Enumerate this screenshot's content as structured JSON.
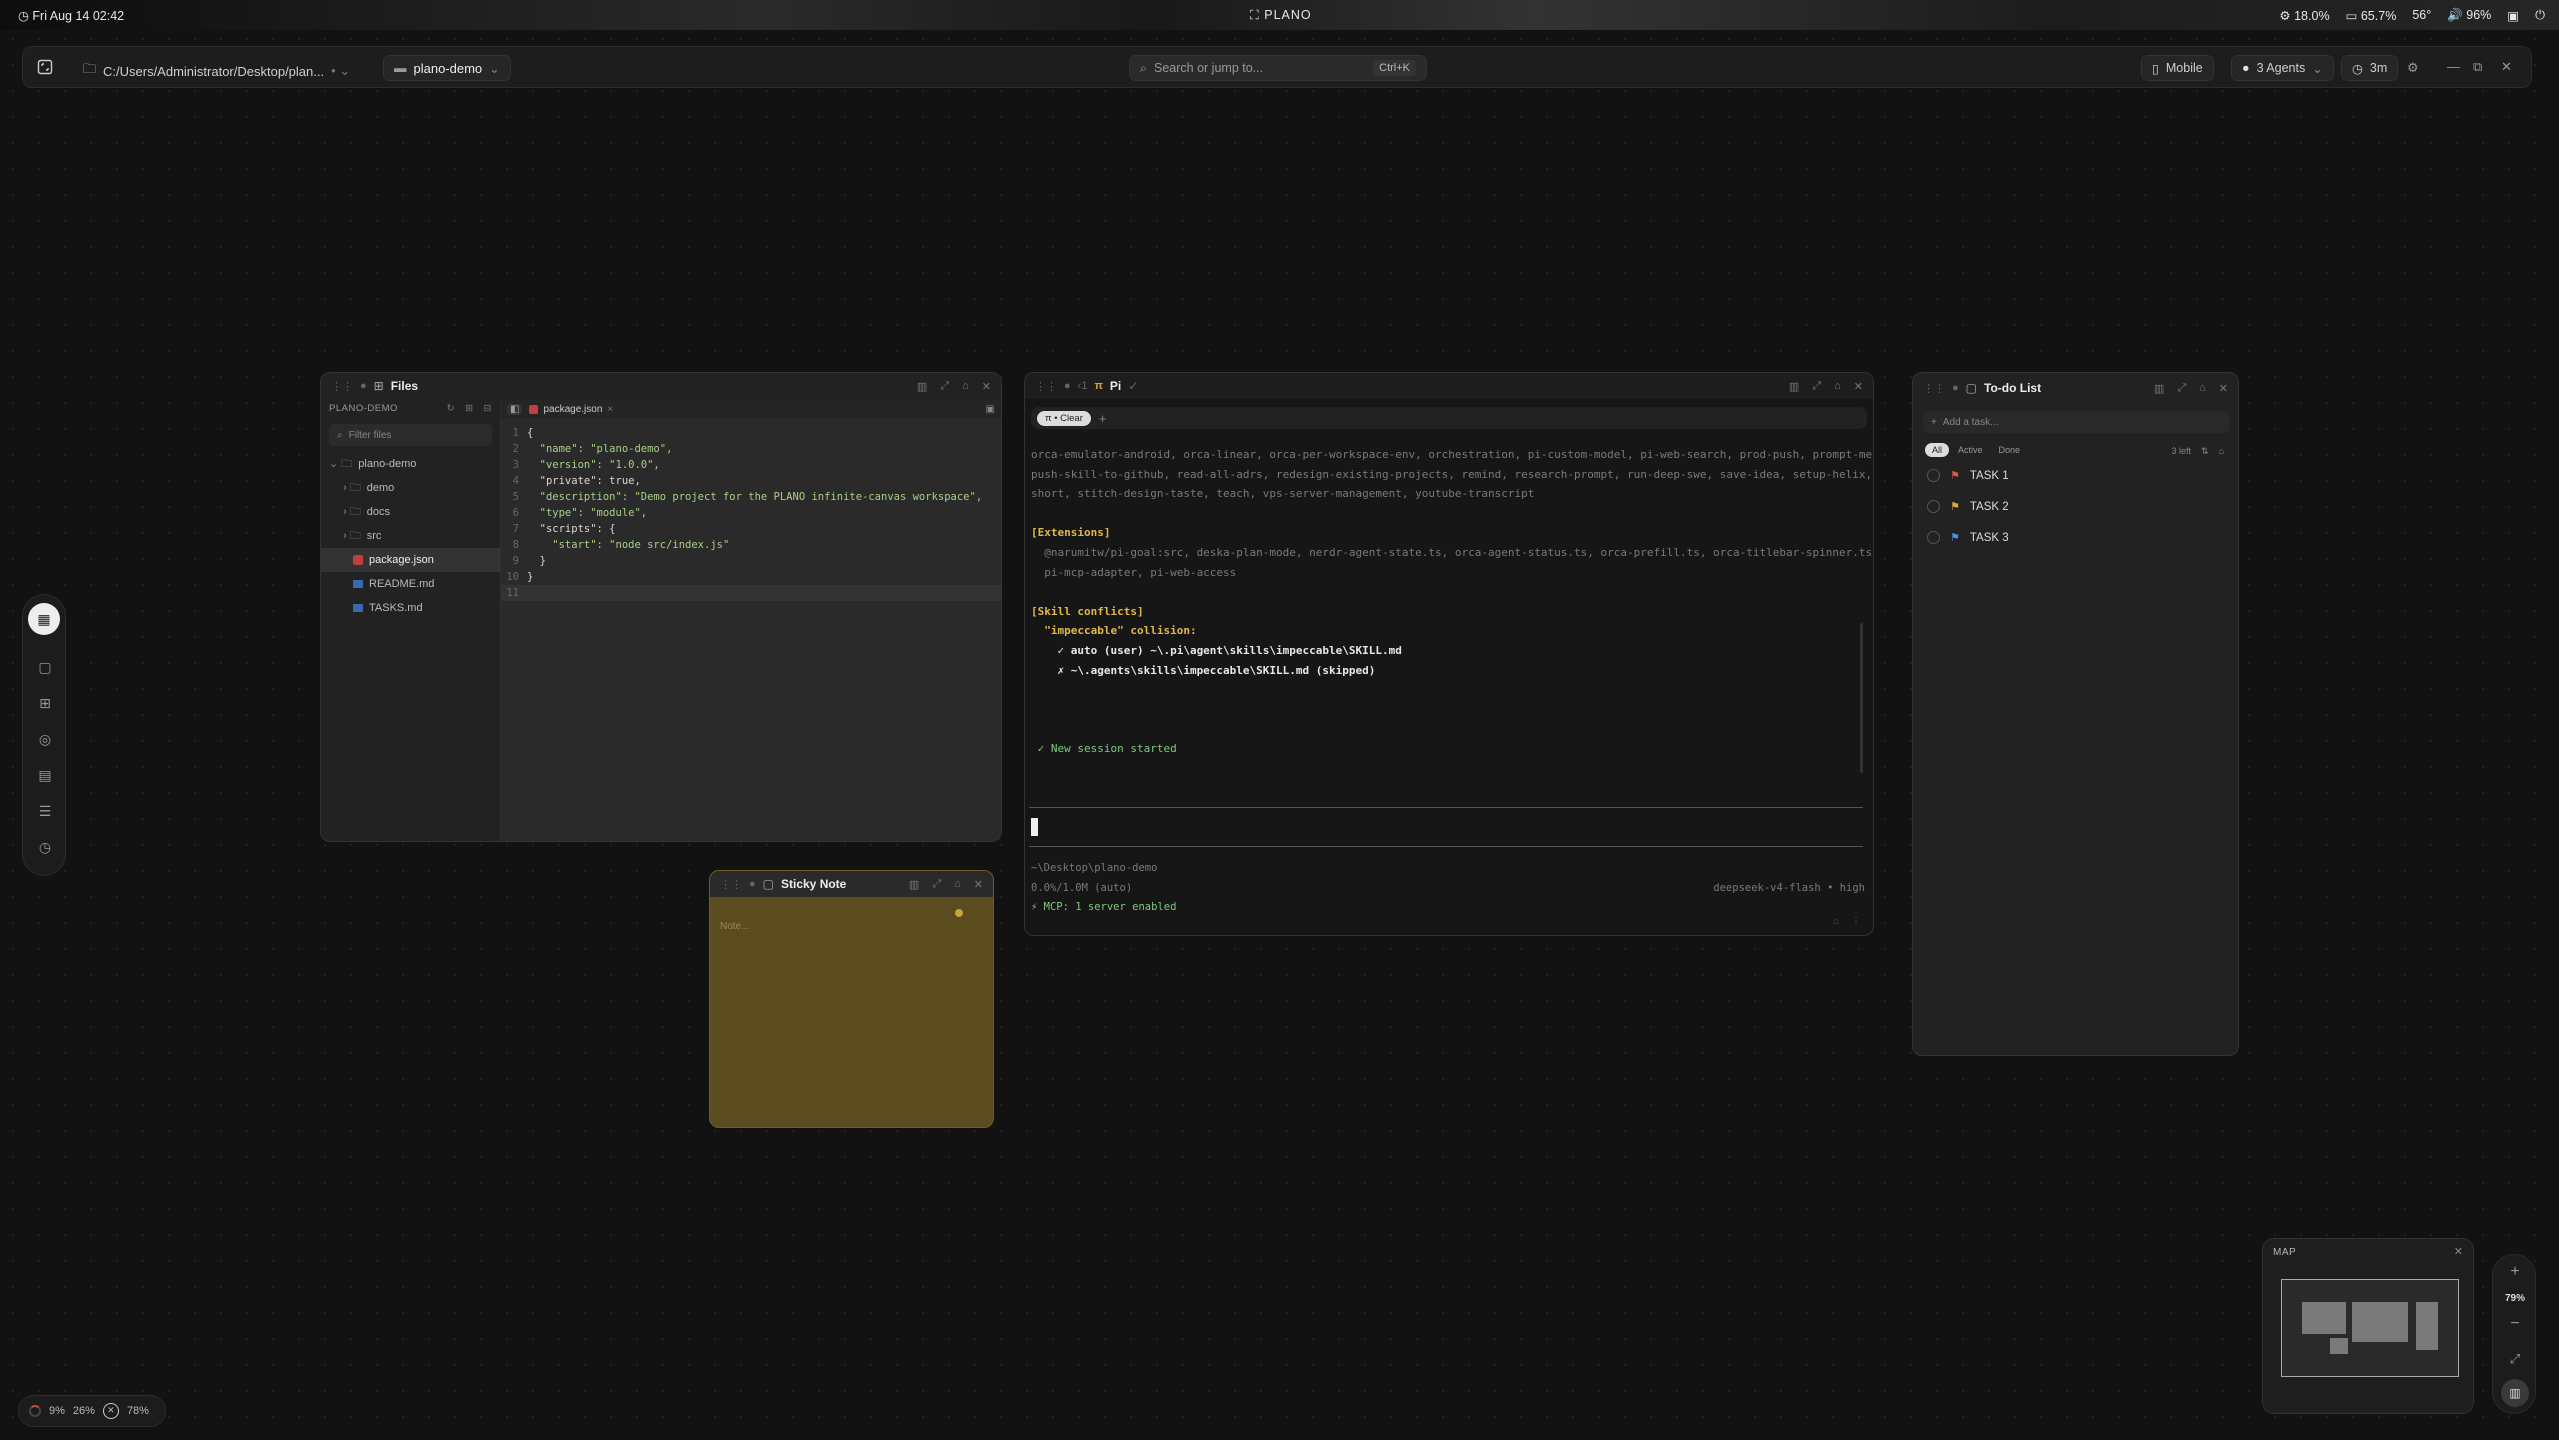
{
  "system_bar": {
    "datetime": "Fri Aug 14 02:42",
    "center_title": "PLANO",
    "cpu": "18.0%",
    "memory": "65.7%",
    "temperature": "56°",
    "volume": "96%"
  },
  "toolbar": {
    "path": "C:/Users/Administrator/Desktop/plan...",
    "project": "plano-demo",
    "search_placeholder": "Search or jump to...",
    "search_shortcut": "Ctrl+K",
    "mobile_label": "Mobile",
    "agents_label": "3 Agents",
    "timer_label": "3m"
  },
  "files_panel": {
    "title": "Files",
    "tree_header": "PLANO-DEMO",
    "filter_placeholder": "Filter files",
    "tree": [
      {
        "label": "plano-demo",
        "type": "folder-open",
        "depth": 0
      },
      {
        "label": "demo",
        "type": "folder",
        "depth": 1
      },
      {
        "label": "docs",
        "type": "folder",
        "depth": 1
      },
      {
        "label": "src",
        "type": "folder",
        "depth": 1
      },
      {
        "label": "package.json",
        "type": "json",
        "depth": 1,
        "active": true
      },
      {
        "label": "README.md",
        "type": "md",
        "depth": 1
      },
      {
        "label": "TASKS.md",
        "type": "md",
        "depth": 1
      }
    ],
    "tab_label": "package.json",
    "code": [
      {
        "n": "1",
        "t": "{"
      },
      {
        "n": "2",
        "t": "  \"name\": \"plano-demo\","
      },
      {
        "n": "3",
        "t": "  \"version\": \"1.0.0\","
      },
      {
        "n": "4",
        "t": "  \"private\": true,"
      },
      {
        "n": "5",
        "t": "  \"description\": \"Demo project for the PLANO infinite-canvas workspace\","
      },
      {
        "n": "6",
        "t": "  \"type\": \"module\","
      },
      {
        "n": "7",
        "t": "  \"scripts\": {"
      },
      {
        "n": "8",
        "t": "    \"start\": \"node src/index.js\""
      },
      {
        "n": "9",
        "t": "  }"
      },
      {
        "n": "10",
        "t": "}"
      },
      {
        "n": "11",
        "t": ""
      }
    ]
  },
  "terminal_panel": {
    "tab_count": "1",
    "title": "Pi",
    "clear_label": "Clear",
    "lines": [
      {
        "style": "dim",
        "text": "orca-emulator-android, orca-linear, orca-per-workspace-env, orchestration, pi-custom-model, pi-web-search, prod-push, prompt-me,"
      },
      {
        "style": "dim",
        "text": "push-skill-to-github, read-all-adrs, redesign-existing-projects, remind, research-prompt, run-deep-swe, save-idea, setup-helix,"
      },
      {
        "style": "dim",
        "text": "short, stitch-design-taste, teach, vps-server-management, youtube-transcript"
      },
      {
        "style": "blank",
        "text": ""
      },
      {
        "style": "yel",
        "text": "[Extensions]"
      },
      {
        "style": "dim",
        "text": "  @narumitw/pi-goal:src, deska-plan-mode, nerdr-agent-state.ts, orca-agent-status.ts, orca-prefill.ts, orca-titlebar-spinner.ts,"
      },
      {
        "style": "dim",
        "text": "  pi-mcp-adapter, pi-web-access"
      },
      {
        "style": "blank",
        "text": ""
      },
      {
        "style": "yel",
        "text": "[Skill conflicts]"
      },
      {
        "style": "yel",
        "text": "  \"impeccable\" collision:"
      },
      {
        "style": "ok",
        "text": "    ✓ auto (user) ~\\.pi\\agent\\skills\\impeccable\\SKILL.md"
      },
      {
        "style": "bad",
        "text": "    ✗ ~\\.agents\\skills\\impeccable\\SKILL.md (skipped)"
      },
      {
        "style": "blank",
        "text": ""
      },
      {
        "style": "blank",
        "text": ""
      },
      {
        "style": "blank",
        "text": ""
      },
      {
        "style": "grn",
        "text": " ✓ New session started"
      }
    ],
    "cwd": "~\\Desktop\\plano-demo",
    "context": "0.0%/1.0M (auto)",
    "model": "deepseek-v4-flash • high",
    "mcp": "⚡ MCP: 1 server enabled"
  },
  "sticky_note": {
    "title": "Sticky Note",
    "placeholder": "Note..."
  },
  "todo_panel": {
    "title": "To-do List",
    "add_placeholder": "Add a task...",
    "filters": [
      "All",
      "Active",
      "Done"
    ],
    "left_count": "3 left",
    "tasks": [
      {
        "label": "TASK 1",
        "flag_color": "#e0574a"
      },
      {
        "label": "TASK 2",
        "flag_color": "#e0a83a"
      },
      {
        "label": "TASK 3",
        "flag_color": "#4a8fe0"
      }
    ]
  },
  "minimap": {
    "title": "MAP"
  },
  "zoom": {
    "level": "79%"
  },
  "stats": {
    "cpu": "9%",
    "gpu": "26%",
    "mem": "78%"
  }
}
